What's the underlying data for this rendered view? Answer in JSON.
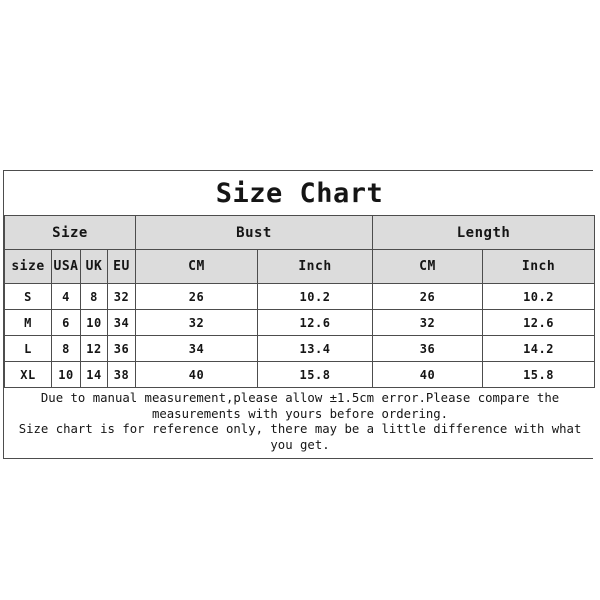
{
  "chart": {
    "title": "Size Chart",
    "group_headers": [
      "Size",
      "Bust",
      "Length"
    ],
    "sub_headers": [
      "size",
      "USA",
      "UK",
      "EU",
      "CM",
      "Inch",
      "CM",
      "Inch"
    ],
    "rows": [
      {
        "size": "S",
        "usa": "4",
        "uk": "8",
        "eu": "32",
        "bust_cm": "26",
        "bust_inch": "10.2",
        "length_cm": "26",
        "length_inch": "10.2"
      },
      {
        "size": "M",
        "usa": "6",
        "uk": "10",
        "eu": "34",
        "bust_cm": "32",
        "bust_inch": "12.6",
        "length_cm": "32",
        "length_inch": "12.6"
      },
      {
        "size": "L",
        "usa": "8",
        "uk": "12",
        "eu": "36",
        "bust_cm": "34",
        "bust_inch": "13.4",
        "length_cm": "36",
        "length_inch": "14.2"
      },
      {
        "size": "XL",
        "usa": "10",
        "uk": "14",
        "eu": "38",
        "bust_cm": "40",
        "bust_inch": "15.8",
        "length_cm": "40",
        "length_inch": "15.8"
      }
    ],
    "notes": [
      "Due to manual measurement,please allow ±1.5cm error.Please compare the measurements with yours before ordering.",
      "Size chart is for reference only, there may be a little difference with what you get."
    ],
    "colors": {
      "header_background": "#dcdcdc",
      "border": "#4d4d4d",
      "text": "#151515",
      "page_background": "#ffffff"
    }
  },
  "chart_data": {
    "type": "table",
    "title": "Size Chart",
    "column_groups": [
      {
        "label": "Size",
        "columns": [
          "size",
          "USA",
          "UK",
          "EU"
        ]
      },
      {
        "label": "Bust",
        "columns": [
          "CM",
          "Inch"
        ]
      },
      {
        "label": "Length",
        "columns": [
          "CM",
          "Inch"
        ]
      }
    ],
    "columns": [
      "size",
      "USA",
      "UK",
      "EU",
      "Bust CM",
      "Bust Inch",
      "Length CM",
      "Length Inch"
    ],
    "rows": [
      [
        "S",
        "4",
        "8",
        "32",
        "26",
        "10.2",
        "26",
        "10.2"
      ],
      [
        "M",
        "6",
        "10",
        "34",
        "32",
        "12.6",
        "32",
        "12.6"
      ],
      [
        "L",
        "8",
        "12",
        "36",
        "34",
        "13.4",
        "36",
        "14.2"
      ],
      [
        "XL",
        "10",
        "14",
        "38",
        "40",
        "15.8",
        "40",
        "15.8"
      ]
    ],
    "units": {
      "bust": [
        "cm",
        "inch"
      ],
      "length": [
        "cm",
        "inch"
      ]
    },
    "notes": [
      "Due to manual measurement,please allow ±1.5cm error.Please compare the measurements with yours before ordering.",
      "Size chart is for reference only, there may be a little difference with what you get."
    ]
  }
}
